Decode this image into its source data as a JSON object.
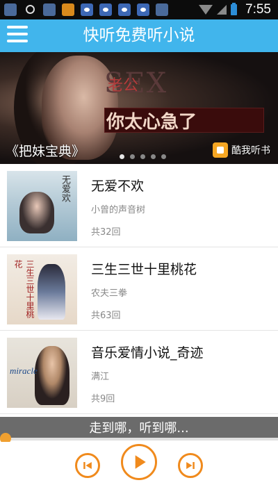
{
  "status_bar": {
    "time": "7:55",
    "icons": [
      "shield-icon",
      "search-icon",
      "shield-icon",
      "orange-app-icon",
      "paw-icon",
      "paw-icon",
      "paw-icon",
      "paw-icon",
      "shield-icon",
      "wifi-icon",
      "signal-icon",
      "battery-icon"
    ]
  },
  "header": {
    "title": "快听免费听小说",
    "menu_icon": "hamburger-menu-icon"
  },
  "banner": {
    "overlay_text_top": "SEX",
    "overlay_text_small": "老公",
    "overlay_text_main": "你太心急了",
    "caption": "《把妹宝典》",
    "dot_count": 5,
    "active_dot": 1,
    "badge_label": "酷我听书"
  },
  "books": [
    {
      "title": "无爱不欢",
      "author": "小曾的声音树",
      "count": "共32回",
      "cover_text": "无爱欢"
    },
    {
      "title": "三生三世十里桃花",
      "author": "农夫三拳",
      "count": "共63回",
      "cover_text": "三生三世十里桃花"
    },
    {
      "title": "音乐爱情小说_奇迹",
      "author": "满江",
      "count": "共9回",
      "cover_text": "miracle"
    }
  ],
  "player": {
    "now_playing": "走到哪，听到哪...",
    "progress": 0.0,
    "accent_color": "#f08a1c",
    "controls": [
      "previous-icon",
      "play-icon",
      "next-icon"
    ]
  },
  "colors": {
    "header_bg": "#41b5ec",
    "accent": "#f08a1c"
  }
}
